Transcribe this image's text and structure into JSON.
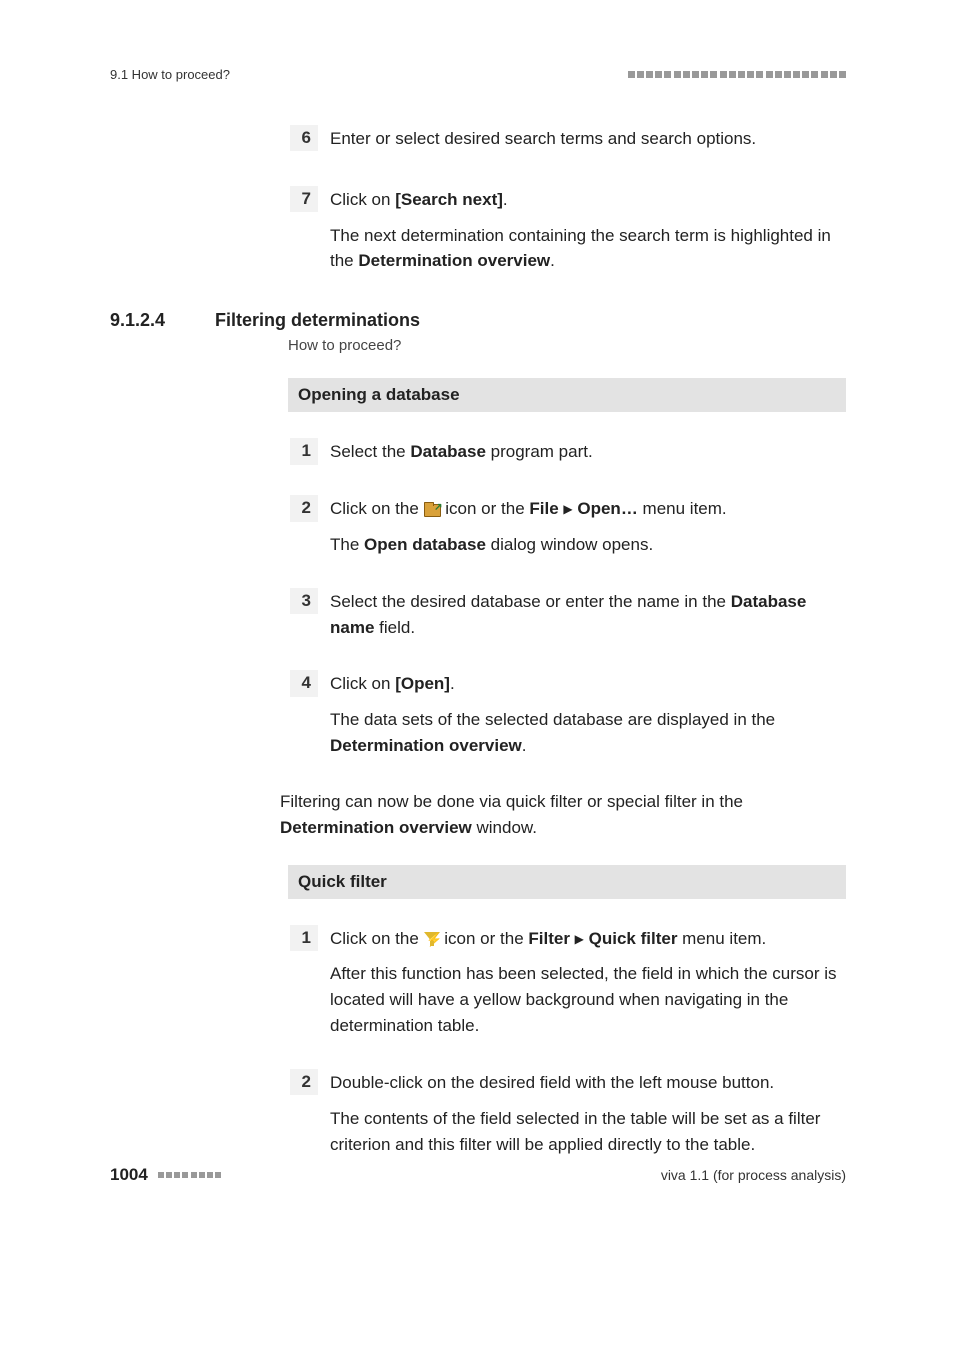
{
  "header": {
    "running_title": "9.1 How to proceed?"
  },
  "step6": {
    "num": "6",
    "text": "Enter or select desired search terms and search options."
  },
  "step7": {
    "num": "7",
    "line1_pre": "Click on ",
    "line1_bold": "[Search next]",
    "line1_post": ".",
    "line2_a": "The next determination containing the search term is highlighted in the ",
    "line2_b": "Determination overview",
    "line2_c": "."
  },
  "section": {
    "num": "9.1.2.4",
    "title": "Filtering determinations",
    "subtitle": "How to proceed?"
  },
  "block1_title": "Opening a database",
  "db1": {
    "num": "1",
    "a": "Select the ",
    "b": "Database",
    "c": " program part."
  },
  "db2": {
    "num": "2",
    "a": "Click on the ",
    "b": " icon or the ",
    "c": "File",
    "d": "Open…",
    "e": " menu item.",
    "f_a": "The ",
    "f_b": "Open database",
    "f_c": " dialog window opens."
  },
  "db3": {
    "num": "3",
    "a": "Select the desired database or enter the name in the ",
    "b": "Database name",
    "c": " field."
  },
  "db4": {
    "num": "4",
    "a": "Click on ",
    "b": "[Open]",
    "c": ".",
    "d_a": "The data sets of the selected database are displayed in the ",
    "d_b": "Determination overview",
    "d_c": "."
  },
  "para": {
    "a": "Filtering can now be done via quick filter or special filter in the ",
    "b": "Determination overview",
    "c": " window."
  },
  "block2_title": "Quick filter",
  "qf1": {
    "num": "1",
    "a": "Click on the ",
    "b": " icon or the ",
    "c": "Filter",
    "d": "Quick filter",
    "e": " menu item.",
    "f": "After this function has been selected, the field in which the cursor is located will have a yellow background when navigating in the determination table."
  },
  "qf2": {
    "num": "2",
    "a": "Double-click on the desired field with the left mouse button.",
    "b": "The contents of the field selected in the table will be set as a filter criterion and this filter will be applied directly to the table."
  },
  "footer": {
    "page": "1004",
    "product": "viva 1.1 (for process analysis)"
  }
}
